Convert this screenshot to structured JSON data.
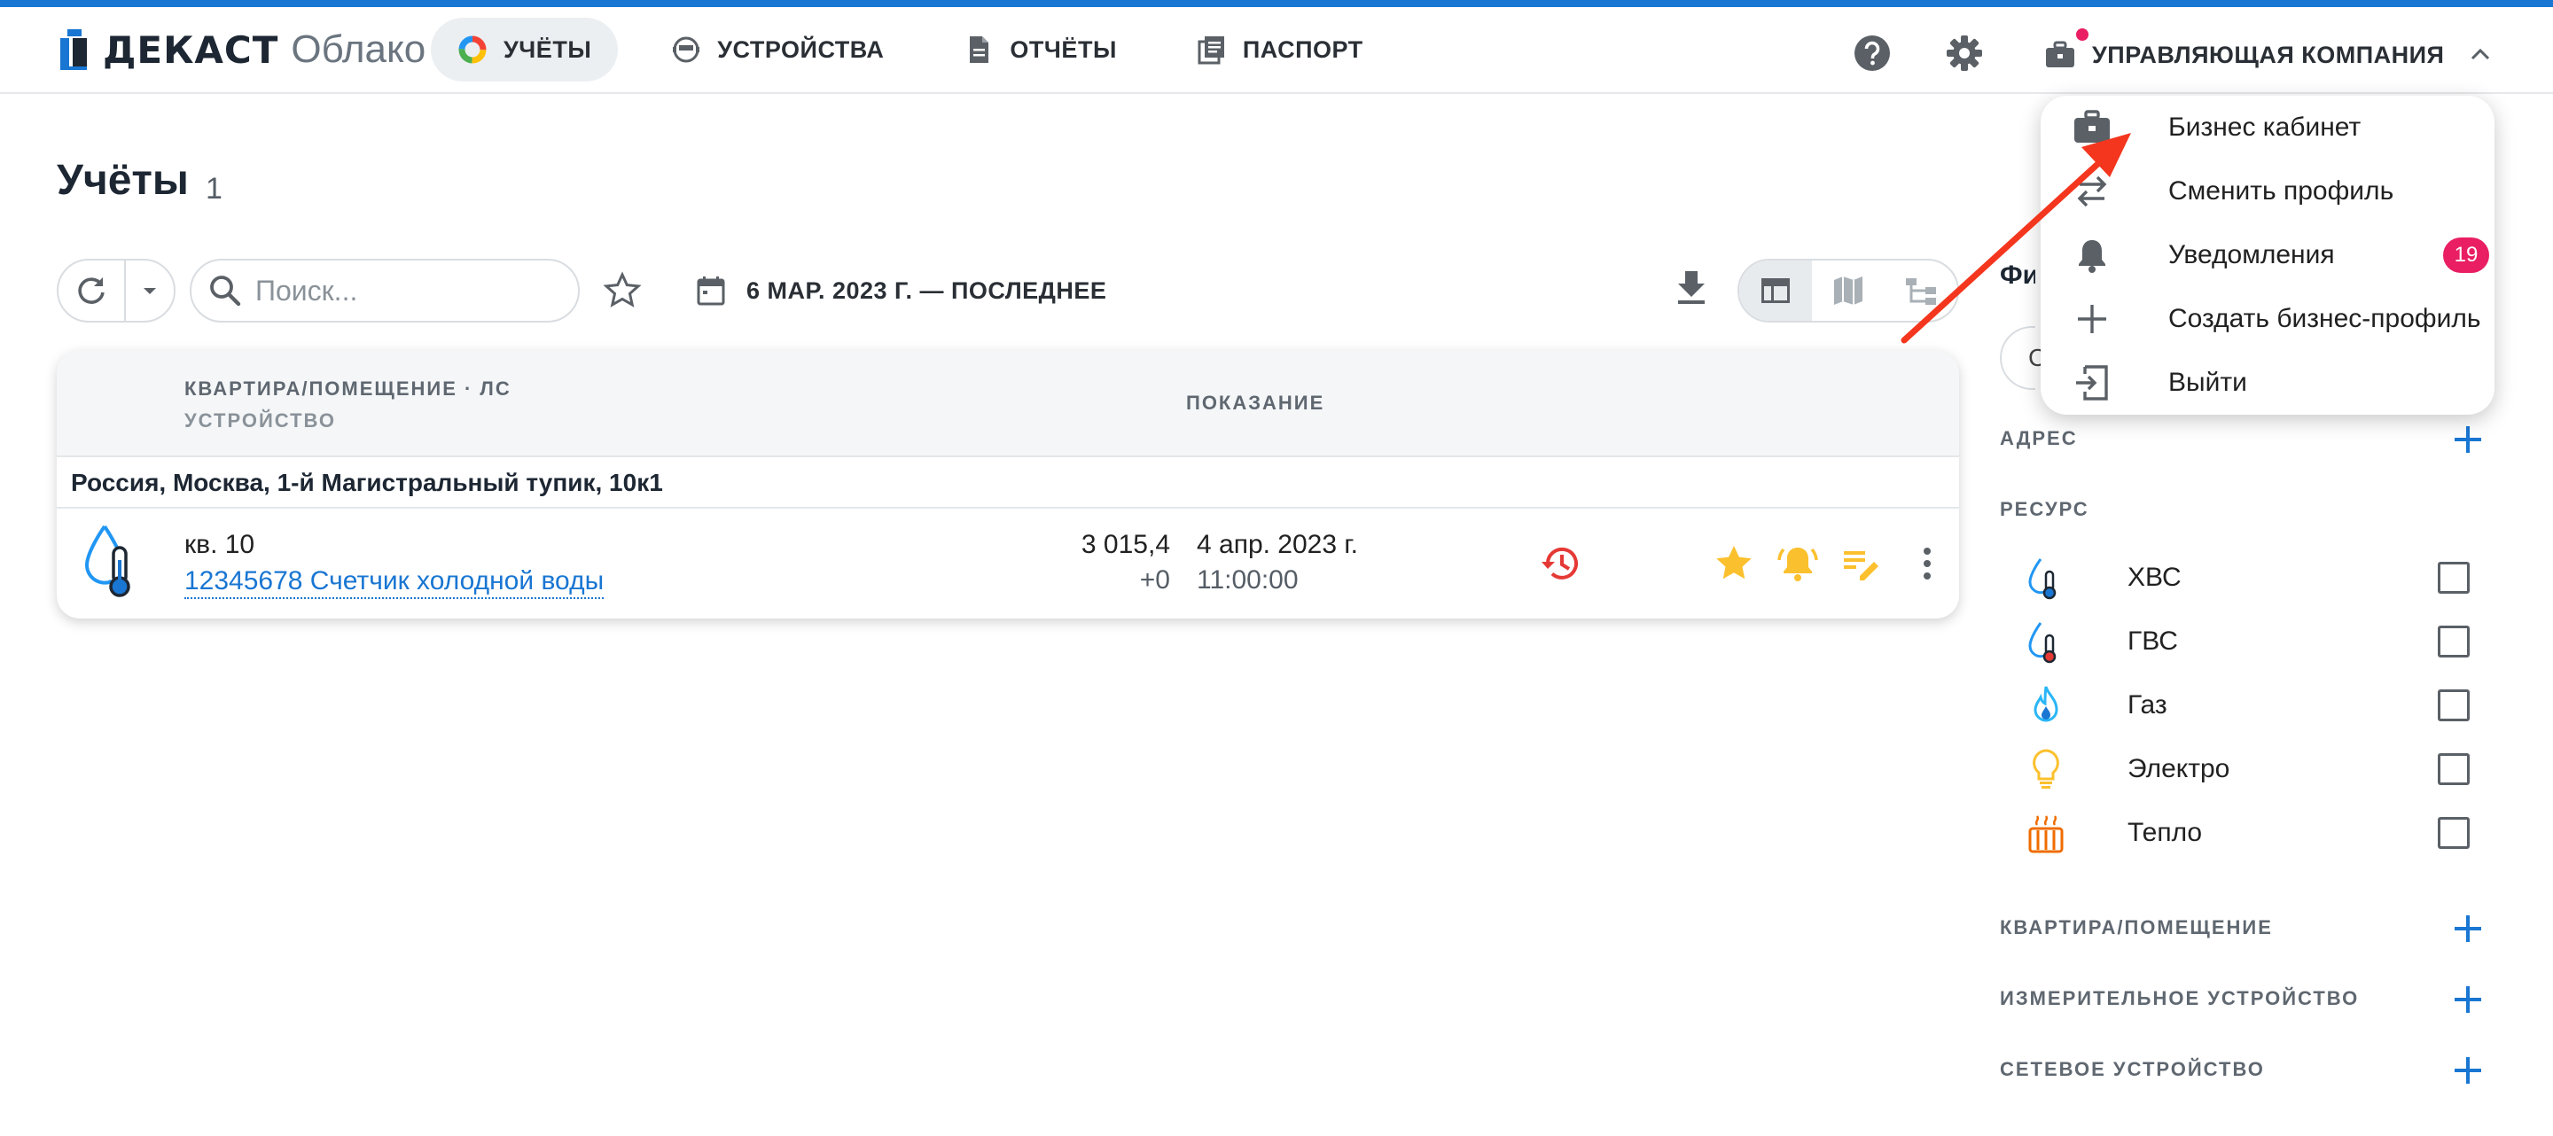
{
  "header": {
    "logo_text": "ДЕКАСТ",
    "logo_sub": "Облако",
    "nav": [
      {
        "label": "УЧЁТЫ",
        "active": true,
        "icon": "pie-chart-icon"
      },
      {
        "label": "УСТРОЙСТВА",
        "active": false,
        "icon": "meter-icon"
      },
      {
        "label": "ОТЧЁТЫ",
        "active": false,
        "icon": "document-icon"
      },
      {
        "label": "ПАСПОРТ",
        "active": false,
        "icon": "passport-icon"
      }
    ],
    "help_icon": "help-icon",
    "settings_icon": "gear-icon",
    "company_label": "УПРАВЛЯЮЩАЯ КОМПАНИЯ"
  },
  "page": {
    "title": "Учёты",
    "count": "1"
  },
  "toolbar": {
    "search_placeholder": "Поиск...",
    "date_range": "6 МАР. 2023 Г. — ПОСЛЕДНЕЕ"
  },
  "table": {
    "col1_line1": "КВАРТИРА/ПОМЕЩЕНИЕ · ЛС",
    "col1_line2": "УСТРОЙСТВО",
    "col2": "ПОКАЗАНИЕ",
    "group": "Россия, Москва, 1-й Магистральный тупик, 10к1",
    "rows": [
      {
        "apartment": "кв. 10",
        "device": "12345678 Счетчик холодной воды",
        "value": "3 015,4",
        "delta": "+0",
        "date": "4 апр. 2023 г.",
        "time": "11:00:00"
      }
    ]
  },
  "filters": {
    "title": "Фильтры",
    "input_char": "С",
    "sections": {
      "address": "АДРЕС",
      "resource": "РЕСУРС",
      "apartment": "КВАРТИРА/ПОМЕЩЕНИЕ",
      "measuring_device": "ИЗМЕРИТЕЛЬНОЕ УСТРОЙСТВО",
      "network_device": "СЕТЕВОЕ УСТРОЙСТВО"
    },
    "resources": [
      {
        "label": "ХВС",
        "icon": "cold-water-icon"
      },
      {
        "label": "ГВС",
        "icon": "hot-water-icon"
      },
      {
        "label": "Газ",
        "icon": "gas-flame-icon"
      },
      {
        "label": "Электро",
        "icon": "lightbulb-icon"
      },
      {
        "label": "Тепло",
        "icon": "radiator-icon"
      }
    ]
  },
  "menu": {
    "items": [
      {
        "label": "Бизнес кабинет",
        "icon": "briefcase-icon"
      },
      {
        "label": "Сменить профиль",
        "icon": "swap-icon"
      },
      {
        "label": "Уведомления",
        "icon": "bell-icon",
        "badge": "19"
      },
      {
        "label": "Создать бизнес-профиль",
        "icon": "plus-icon"
      },
      {
        "label": "Выйти",
        "icon": "logout-icon"
      }
    ]
  },
  "colors": {
    "accent": "#1976d2",
    "badge": "#e91e63",
    "history": "#e53935",
    "amber": "#fbc02d",
    "arrow": "#f4361e"
  }
}
